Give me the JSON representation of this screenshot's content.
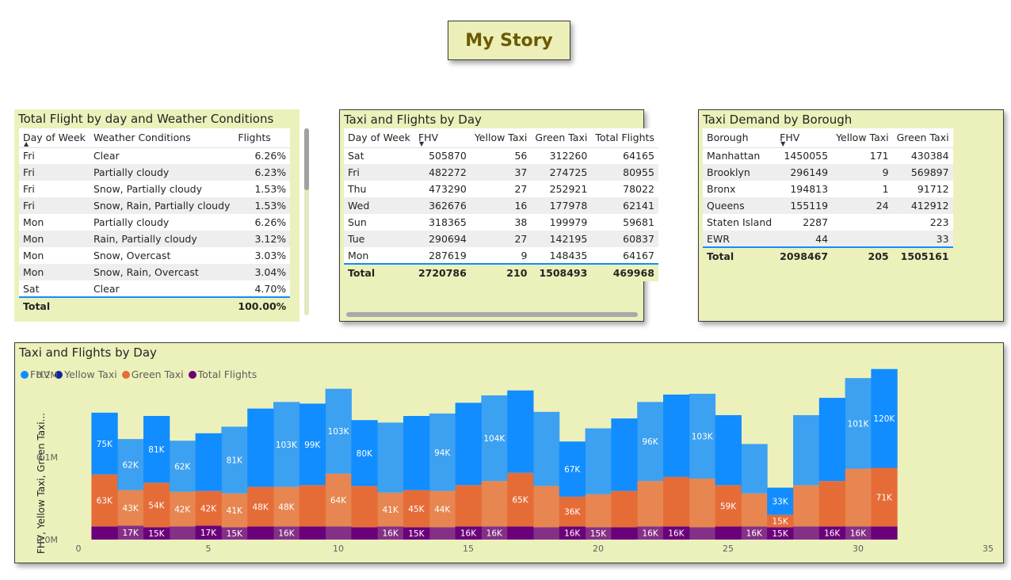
{
  "page": {
    "title": "My Story"
  },
  "weather_table": {
    "title": "Total Flight by day and Weather Conditions",
    "headers": [
      "Day of Week",
      "Weather Conditions",
      "Flights"
    ],
    "rows": [
      [
        "Fri",
        "Clear",
        "6.26%"
      ],
      [
        "Fri",
        "Partially cloudy",
        "6.23%"
      ],
      [
        "Fri",
        "Snow, Partially cloudy",
        "1.53%"
      ],
      [
        "Fri",
        "Snow, Rain, Partially cloudy",
        "1.53%"
      ],
      [
        "Mon",
        "Partially cloudy",
        "6.26%"
      ],
      [
        "Mon",
        "Rain, Partially cloudy",
        "3.12%"
      ],
      [
        "Mon",
        "Snow, Overcast",
        "3.03%"
      ],
      [
        "Mon",
        "Snow, Rain, Overcast",
        "3.04%"
      ],
      [
        "Sat",
        "Clear",
        "4.70%"
      ]
    ],
    "total": [
      "Total",
      "",
      "100.00%"
    ]
  },
  "day_table": {
    "title": "Taxi and Flights by Day",
    "headers": [
      "Day of Week",
      "FHV",
      "Yellow Taxi",
      "Green Taxi",
      "Total Flights"
    ],
    "rows": [
      [
        "Sat",
        "505870",
        "56",
        "312260",
        "64165"
      ],
      [
        "Fri",
        "482272",
        "37",
        "274725",
        "80955"
      ],
      [
        "Thu",
        "473290",
        "27",
        "252921",
        "78022"
      ],
      [
        "Wed",
        "362676",
        "16",
        "177978",
        "62141"
      ],
      [
        "Sun",
        "318365",
        "38",
        "199979",
        "59681"
      ],
      [
        "Tue",
        "290694",
        "27",
        "142195",
        "60837"
      ],
      [
        "Mon",
        "287619",
        "9",
        "148435",
        "64167"
      ]
    ],
    "total": [
      "Total",
      "2720786",
      "210",
      "1508493",
      "469968"
    ]
  },
  "borough_table": {
    "title": "Taxi Demand by Borough",
    "headers": [
      "Borough",
      "FHV",
      "Yellow Taxi",
      "Green Taxi"
    ],
    "rows": [
      [
        "Manhattan",
        "1450055",
        "171",
        "430384"
      ],
      [
        "Brooklyn",
        "296149",
        "9",
        "569897"
      ],
      [
        "Bronx",
        "194813",
        "1",
        "91712"
      ],
      [
        "Queens",
        "155119",
        "24",
        "412912"
      ],
      [
        "Staten Island",
        "2287",
        "",
        "223"
      ],
      [
        "EWR",
        "44",
        "",
        "33"
      ]
    ],
    "total": [
      "Total",
      "2098467",
      "205",
      "1505161"
    ]
  },
  "chart_data": {
    "type": "area",
    "title": "Taxi and Flights by Day",
    "ylabel": "FHV, Yellow Taxi, Green Taxi...",
    "xlim": [
      0,
      35
    ],
    "ylim": [
      0,
      200000
    ],
    "xticks": [
      0,
      5,
      10,
      15,
      20,
      25,
      30,
      35
    ],
    "yticks": [
      {
        "value": 0,
        "label": "0.0M"
      },
      {
        "value": 100000,
        "label": "0.1M"
      },
      {
        "value": 200000,
        "label": "0.2M"
      }
    ],
    "stacked": true,
    "x": [
      1,
      2,
      3,
      4,
      5,
      6,
      7,
      8,
      9,
      10,
      11,
      12,
      13,
      14,
      15,
      16,
      17,
      18,
      19,
      20,
      21,
      22,
      23,
      24,
      25,
      26,
      27,
      28,
      29,
      30,
      31
    ],
    "series": [
      {
        "name": "FHV",
        "color": "#118dff",
        "values": [
          75000,
          62000,
          81000,
          62000,
          70000,
          81000,
          95000,
          103000,
          99000,
          103000,
          80000,
          85000,
          90000,
          94000,
          100000,
          104000,
          100000,
          90000,
          67000,
          80000,
          88000,
          96000,
          100000,
          103000,
          85000,
          60000,
          33000,
          85000,
          101000,
          110000,
          120000
        ]
      },
      {
        "name": "Yellow Taxi",
        "color": "#12239e",
        "values": [
          7,
          6,
          7,
          6,
          6,
          6,
          7,
          8,
          7,
          8,
          7,
          6,
          6,
          6,
          7,
          8,
          8,
          7,
          5,
          6,
          7,
          7,
          7,
          8,
          7,
          6,
          3,
          6,
          7,
          8,
          9
        ]
      },
      {
        "name": "Green Taxi",
        "color": "#e66c37",
        "values": [
          63000,
          43000,
          54000,
          42000,
          42000,
          41000,
          48000,
          48000,
          50000,
          64000,
          50000,
          41000,
          45000,
          44000,
          50000,
          55000,
          65000,
          50000,
          36000,
          40000,
          44000,
          55000,
          60000,
          59000,
          50000,
          40000,
          15000,
          50000,
          55000,
          70000,
          71000
        ]
      },
      {
        "name": "Total Flights",
        "color": "#6b007b",
        "values": [
          16000,
          17000,
          15000,
          16000,
          17000,
          15000,
          16000,
          16000,
          16000,
          16000,
          15000,
          16000,
          15000,
          15000,
          16000,
          16000,
          16000,
          15000,
          16000,
          15000,
          15000,
          16000,
          16000,
          15000,
          16000,
          16000,
          15000,
          16000,
          16000,
          16000,
          16000
        ]
      }
    ],
    "data_labels": [
      {
        "x": 1,
        "series": "FHV",
        "text": "75K"
      },
      {
        "x": 2,
        "series": "FHV",
        "text": "62K"
      },
      {
        "x": 3,
        "series": "FHV",
        "text": "81K"
      },
      {
        "x": 4,
        "series": "FHV",
        "text": "62K"
      },
      {
        "x": 6,
        "series": "FHV",
        "text": "81K"
      },
      {
        "x": 8,
        "series": "FHV",
        "text": "103K"
      },
      {
        "x": 9,
        "series": "FHV",
        "text": "99K"
      },
      {
        "x": 10,
        "series": "FHV",
        "text": "103K"
      },
      {
        "x": 11,
        "series": "FHV",
        "text": "80K"
      },
      {
        "x": 14,
        "series": "FHV",
        "text": "94K"
      },
      {
        "x": 16,
        "series": "FHV",
        "text": "104K"
      },
      {
        "x": 19,
        "series": "FHV",
        "text": "67K"
      },
      {
        "x": 22,
        "series": "FHV",
        "text": "96K"
      },
      {
        "x": 24,
        "series": "FHV",
        "text": "103K"
      },
      {
        "x": 27,
        "series": "FHV",
        "text": "33K"
      },
      {
        "x": 30,
        "series": "FHV",
        "text": "101K"
      },
      {
        "x": 31,
        "series": "FHV",
        "text": "120K"
      },
      {
        "x": 1,
        "series": "Green Taxi",
        "text": "63K"
      },
      {
        "x": 2,
        "series": "Green Taxi",
        "text": "43K"
      },
      {
        "x": 3,
        "series": "Green Taxi",
        "text": "54K"
      },
      {
        "x": 4,
        "series": "Green Taxi",
        "text": "42K"
      },
      {
        "x": 5,
        "series": "Green Taxi",
        "text": "42K"
      },
      {
        "x": 6,
        "series": "Green Taxi",
        "text": "41K"
      },
      {
        "x": 7,
        "series": "Green Taxi",
        "text": "48K"
      },
      {
        "x": 8,
        "series": "Green Taxi",
        "text": "48K"
      },
      {
        "x": 10,
        "series": "Green Taxi",
        "text": "64K"
      },
      {
        "x": 12,
        "series": "Green Taxi",
        "text": "41K"
      },
      {
        "x": 13,
        "series": "Green Taxi",
        "text": "45K"
      },
      {
        "x": 14,
        "series": "Green Taxi",
        "text": "44K"
      },
      {
        "x": 17,
        "series": "Green Taxi",
        "text": "65K"
      },
      {
        "x": 19,
        "series": "Green Taxi",
        "text": "36K"
      },
      {
        "x": 25,
        "series": "Green Taxi",
        "text": "59K"
      },
      {
        "x": 27,
        "series": "Green Taxi",
        "text": "15K"
      },
      {
        "x": 31,
        "series": "Green Taxi",
        "text": "71K"
      },
      {
        "x": 2,
        "series": "Total Flights",
        "text": "17K"
      },
      {
        "x": 3,
        "series": "Total Flights",
        "text": "15K"
      },
      {
        "x": 5,
        "series": "Total Flights",
        "text": "17K"
      },
      {
        "x": 6,
        "series": "Total Flights",
        "text": "15K"
      },
      {
        "x": 8,
        "series": "Total Flights",
        "text": "16K"
      },
      {
        "x": 12,
        "series": "Total Flights",
        "text": "16K"
      },
      {
        "x": 13,
        "series": "Total Flights",
        "text": "15K"
      },
      {
        "x": 15,
        "series": "Total Flights",
        "text": "16K"
      },
      {
        "x": 16,
        "series": "Total Flights",
        "text": "16K"
      },
      {
        "x": 19,
        "series": "Total Flights",
        "text": "16K"
      },
      {
        "x": 20,
        "series": "Total Flights",
        "text": "15K"
      },
      {
        "x": 22,
        "series": "Total Flights",
        "text": "16K"
      },
      {
        "x": 23,
        "series": "Total Flights",
        "text": "16K"
      },
      {
        "x": 26,
        "series": "Total Flights",
        "text": "16K"
      },
      {
        "x": 27,
        "series": "Total Flights",
        "text": "15K"
      },
      {
        "x": 29,
        "series": "Total Flights",
        "text": "16K"
      },
      {
        "x": 30,
        "series": "Total Flights",
        "text": "16K"
      }
    ],
    "legend_position": "top-left",
    "grid": false
  }
}
